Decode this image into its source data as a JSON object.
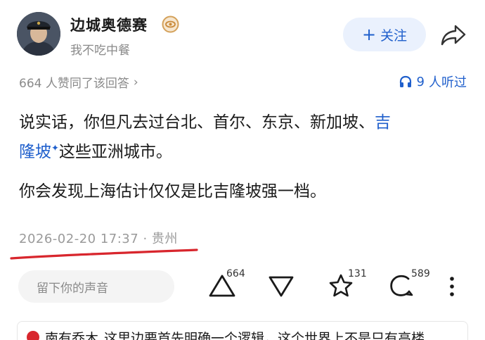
{
  "author": {
    "name": "边城奥德赛",
    "bio": "我不吃中餐",
    "badge_icon": "badge-icon",
    "avatar_icon": "avatar"
  },
  "actions": {
    "follow_plus": "+",
    "follow_label": "关注",
    "share_icon": "share-icon"
  },
  "stats": {
    "votes_text": "664 人赞同了该回答",
    "votes_chevron": "›",
    "listen_count": "9",
    "listen_label": "人听过"
  },
  "answer": {
    "line1_text": "说实话，你但凡去过台北、首尔、东京、新加坡、",
    "line1_link": "吉",
    "line2_link": "隆坡",
    "link_marker": "✦",
    "line2_rest": "这些亚洲城市。",
    "paragraph2": "你会发现上海估计仅仅是比吉隆坡强一档。"
  },
  "meta": {
    "datetime": "2026-02-20 17:37",
    "separator": "·",
    "location": "贵州"
  },
  "toolbar": {
    "comment_placeholder": "留下你的声音",
    "upvote_count": "664",
    "favorite_count": "131",
    "comment_count": "589"
  },
  "bottom_comment": {
    "author": "南有乔木",
    "text": "这里边要首先明确一个逻辑，这个世界上不是只有高楼"
  },
  "colors": {
    "accent": "#1f5fcc",
    "follow_bg": "#eaf1fd",
    "underline": "#d8262d",
    "muted": "#8a8a8a"
  }
}
